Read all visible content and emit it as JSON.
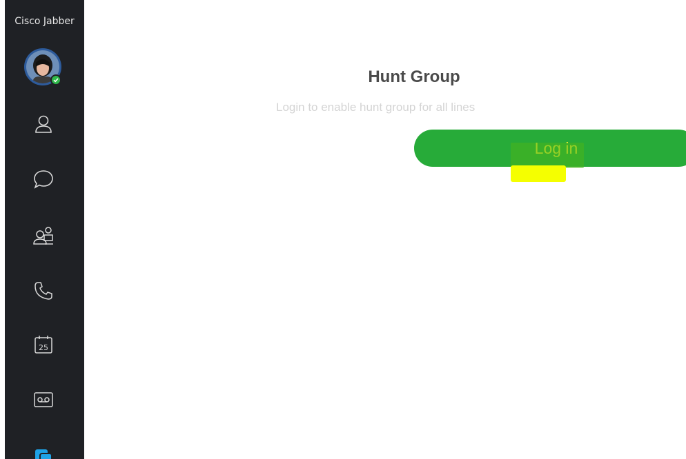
{
  "app": {
    "title": "Cisco Jabber"
  },
  "sidebar": {
    "presence": "available",
    "items": [
      {
        "name": "contacts",
        "icon": "person-icon"
      },
      {
        "name": "chats",
        "icon": "chat-bubble-icon"
      },
      {
        "name": "meetings",
        "icon": "group-icon"
      },
      {
        "name": "calls",
        "icon": "phone-icon"
      },
      {
        "name": "calendar",
        "icon": "calendar-icon",
        "badge": "25"
      },
      {
        "name": "voicemail",
        "icon": "voicemail-icon"
      },
      {
        "name": "custom",
        "icon": "stacked-windows-icon"
      }
    ]
  },
  "hunt_group": {
    "title": "Hunt Group",
    "subtitle": "Login to enable hunt group for all lines",
    "login_label": "Log in"
  },
  "colors": {
    "sidebar_bg": "#1f2125",
    "accent_green": "#27ab39",
    "highlight_yellow": "#f5ff00",
    "active_icon_blue": "#1ea2e6"
  }
}
